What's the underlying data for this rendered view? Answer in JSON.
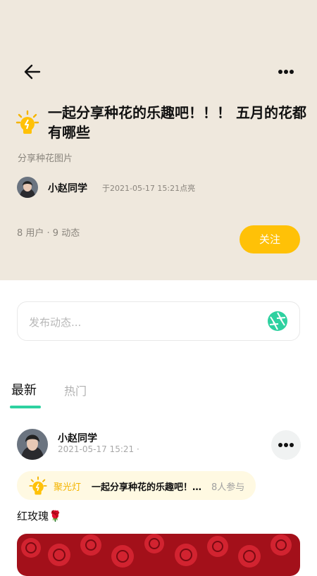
{
  "header": {
    "title": "一起分享种花的乐趣吧！！！ 五月的花都有哪些",
    "subtitle": "分享种花图片",
    "creator_name": "小赵同学",
    "created_at": "于2021-05-17 15:21点亮",
    "stats": "8 用户 · 9 动态",
    "follow_label": "关注"
  },
  "compose": {
    "placeholder": "发布动态..."
  },
  "tabs": [
    {
      "label": "最新",
      "active": true
    },
    {
      "label": "热门",
      "active": false
    }
  ],
  "post": {
    "author": "小赵同学",
    "time": "2021-05-17 15:21 ·",
    "spotlight_label": "聚光灯",
    "spotlight_topic": "一起分享种花的乐趣吧！！！ 五月的花都有哪些",
    "spotlight_count": "8人参与",
    "text": "红玫瑰🌹"
  },
  "colors": {
    "header_bg": "#efe8dd",
    "accent_yellow": "#ffc107",
    "accent_green": "#2ed1a0"
  },
  "icons": [
    "back-arrow-icon",
    "more-icon",
    "lightbulb-icon",
    "camera-shutter-icon"
  ]
}
